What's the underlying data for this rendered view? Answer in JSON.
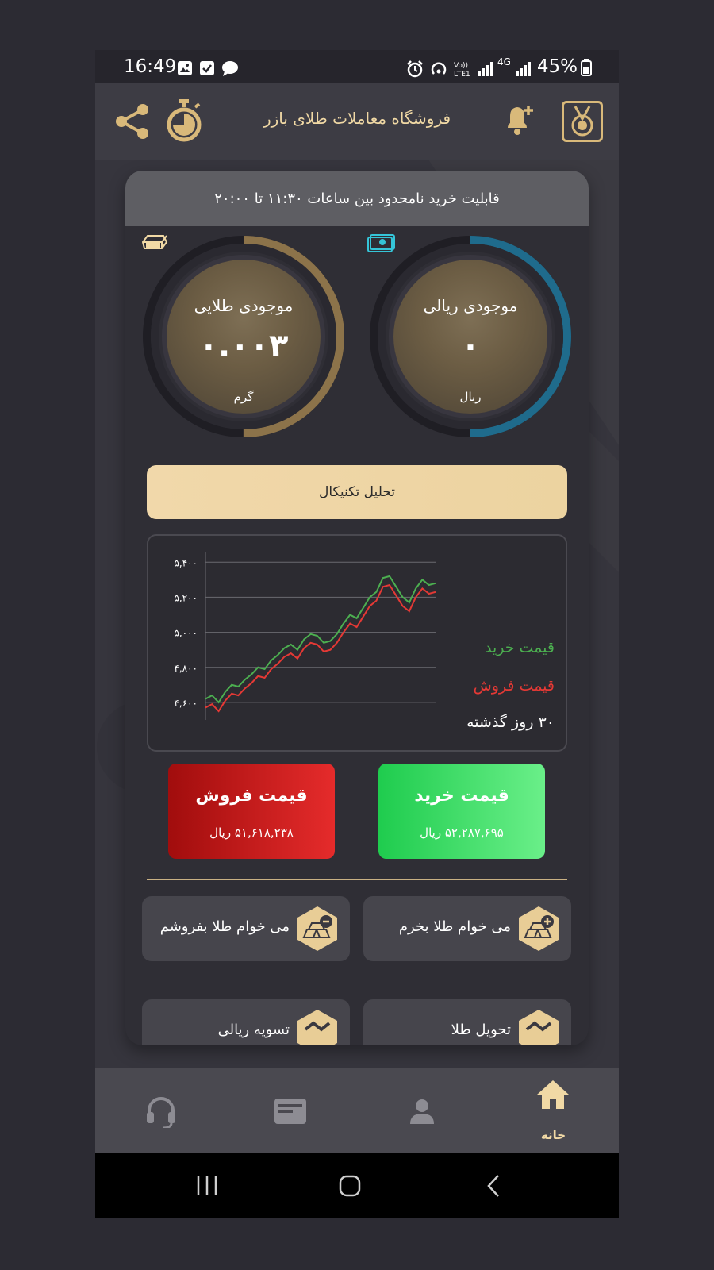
{
  "status_bar": {
    "time": "16:49",
    "battery": "45%",
    "network": "4G",
    "icons": [
      "image-icon",
      "checkbox-icon",
      "chat-icon",
      "alarm-icon",
      "hotspot-icon",
      "volte-icon",
      "signal-icon",
      "signal-icon",
      "battery-icon"
    ]
  },
  "app_bar": {
    "title": "فروشگاه معاملات طلای بازر",
    "icons": [
      "share-icon",
      "timer-icon",
      "bell-plus-icon",
      "medal-logo-icon"
    ]
  },
  "notice": "قابلیت خرید نامحدود بین ساعات ۱۱:۳۰ تا ۲۰:۰۰",
  "balances": {
    "gold": {
      "title": "موجودی طلایی",
      "value": "۰.۰۰۳",
      "unit": "گرم",
      "fraction": 0.5,
      "color": "#8c734a"
    },
    "rial": {
      "title": "موجودی ریالی",
      "value": "۰",
      "unit": "ریال",
      "fraction": 0.5,
      "color": "#1f6b8c"
    }
  },
  "analysis_button": "تحلیل تکنیکال",
  "chart_data": {
    "type": "line",
    "y_ticks": [
      "۵,۴۰۰",
      "۵,۲۰۰",
      "۵,۰۰۰",
      "۴,۸۰۰",
      "۴,۶۰۰"
    ],
    "y_tick_values": [
      5400,
      5200,
      5000,
      4800,
      4600
    ],
    "ylim": [
      4500,
      5460
    ],
    "grid": true,
    "legend_position": "right",
    "x_label": "۳۰ روز گذشته",
    "series": [
      {
        "name": "قیمت خرید",
        "color": "#4caf50",
        "values": [
          4620,
          4640,
          4600,
          4660,
          4700,
          4690,
          4730,
          4760,
          4800,
          4790,
          4840,
          4870,
          4910,
          4930,
          4900,
          4960,
          4990,
          4980,
          4940,
          4950,
          4990,
          5050,
          5100,
          5080,
          5140,
          5200,
          5230,
          5310,
          5320,
          5260,
          5200,
          5170,
          5250,
          5300,
          5270,
          5280
        ]
      },
      {
        "name": "قیمت فروش",
        "color": "#e53935",
        "values": [
          4570,
          4590,
          4550,
          4610,
          4650,
          4640,
          4680,
          4710,
          4750,
          4740,
          4790,
          4820,
          4860,
          4880,
          4850,
          4910,
          4940,
          4930,
          4890,
          4900,
          4940,
          5000,
          5050,
          5030,
          5090,
          5150,
          5180,
          5260,
          5270,
          5210,
          5150,
          5120,
          5200,
          5250,
          5220,
          5230
        ]
      }
    ]
  },
  "prices": {
    "buy": {
      "title": "قیمت خرید",
      "value": "۵۲,۲۸۷,۶۹۵ ریال"
    },
    "sell": {
      "title": "قیمت فروش",
      "value": "۵۱,۶۱۸,۲۳۸ ریال"
    }
  },
  "actions": {
    "buy": "می خوام طلا بخرم",
    "sell": "می خوام طلا بفروشم",
    "transfer": "تحویل طلا",
    "settle": "تسویه ریالی"
  },
  "bottom_nav": {
    "home_label": "خانه",
    "items": [
      "home-icon",
      "profile-icon",
      "card-icon",
      "headset-icon"
    ]
  },
  "colors": {
    "accent_gold": "#f1d9a5",
    "buy_green": "#22c55e",
    "sell_red": "#dc2626"
  }
}
